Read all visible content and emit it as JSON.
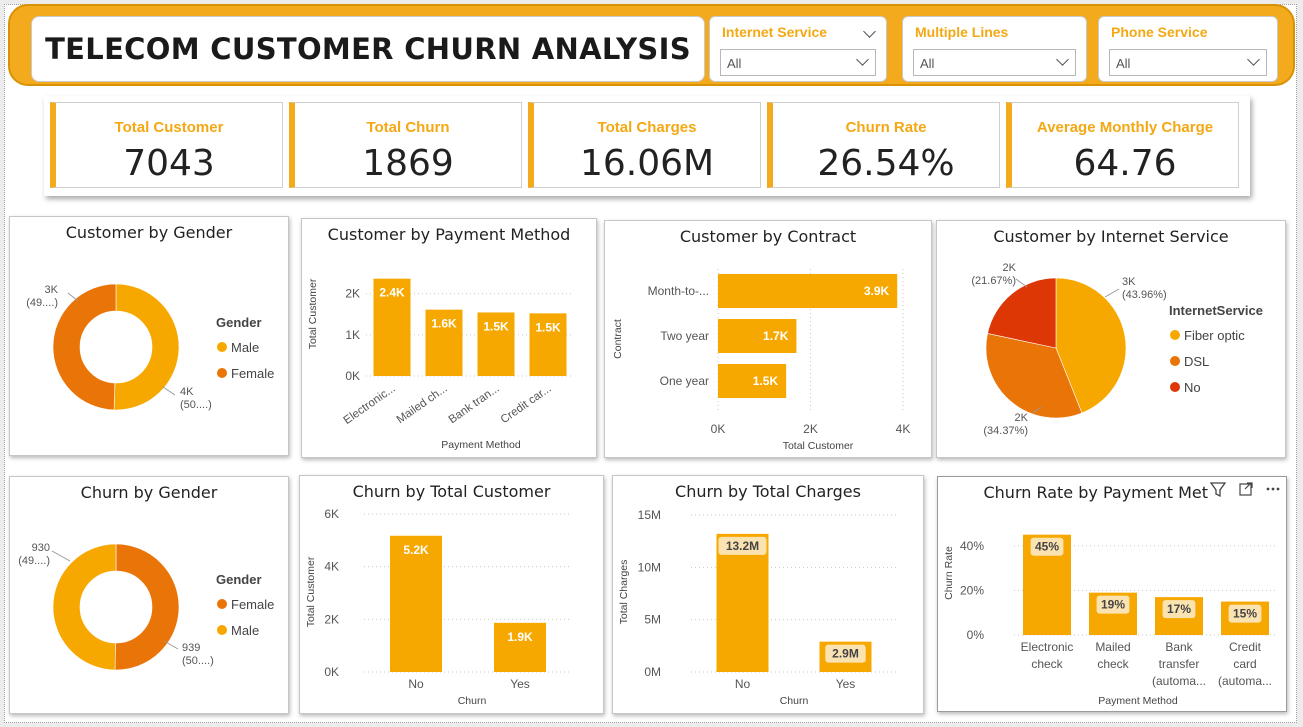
{
  "header": {
    "title": "TELECOM CUSTOMER CHURN ANALYSIS",
    "slicers": [
      {
        "label": "Internet Service",
        "value": "All"
      },
      {
        "label": "Multiple Lines",
        "value": "All"
      },
      {
        "label": "Phone Service",
        "value": "All"
      }
    ]
  },
  "kpis": [
    {
      "label": "Total Customer",
      "value": "7043"
    },
    {
      "label": "Total Churn",
      "value": "1869"
    },
    {
      "label": "Total Charges",
      "value": "16.06M"
    },
    {
      "label": "Churn Rate",
      "value": "26.54%"
    },
    {
      "label": "Average Monthly Charge",
      "value": "64.76"
    }
  ],
  "colors": {
    "accent": "#f3ab1d",
    "bar": "#f7a800",
    "orange": "#e97408",
    "red": "#dd3706",
    "label_bg": "#fbe3b1"
  },
  "chart_data": [
    {
      "type": "pie",
      "donut": true,
      "title": "Customer by Gender",
      "legend_title": "Gender",
      "categories": [
        "Male",
        "Female"
      ],
      "values": [
        3555,
        3488
      ],
      "data_labels": [
        "4K\n(50....)",
        "3K\n(49....)"
      ],
      "colors": [
        "#f7a800",
        "#e97408"
      ],
      "legend": "right"
    },
    {
      "type": "bar",
      "title": "Customer by Payment Method",
      "categories": [
        "Electronic...",
        "Mailed ch...",
        "Bank tran...",
        "Credit car..."
      ],
      "values": [
        2365,
        1612,
        1544,
        1522
      ],
      "data_labels": [
        "2.4K",
        "1.6K",
        "1.5K",
        "1.5K"
      ],
      "ylabel": "Total Customer",
      "xlabel": "Payment Method",
      "yticks": [
        "0K",
        "1K",
        "2K"
      ],
      "ylim": [
        0,
        2600
      ]
    },
    {
      "type": "bar",
      "orientation": "horizontal",
      "title": "Customer by Contract",
      "categories": [
        "Month-to-...",
        "Two year",
        "One year"
      ],
      "values": [
        3875,
        1695,
        1473
      ],
      "data_labels": [
        "3.9K",
        "1.7K",
        "1.5K"
      ],
      "ylabel": "Contract",
      "xlabel": "Total Customer",
      "xticks": [
        "0K",
        "2K",
        "4K"
      ],
      "xlim": [
        0,
        4000
      ]
    },
    {
      "type": "pie",
      "title": "Customer by Internet Service",
      "legend_title": "InternetService",
      "categories": [
        "Fiber optic",
        "DSL",
        "No"
      ],
      "values": [
        43.96,
        34.37,
        21.67
      ],
      "data_labels": [
        "3K\n(43.96%)",
        "2K\n(34.37%)",
        "2K\n(21.67%)"
      ],
      "colors": [
        "#f7a800",
        "#e97408",
        "#dd3706"
      ],
      "legend": "right"
    },
    {
      "type": "pie",
      "donut": true,
      "title": "Churn by Gender",
      "legend_title": "Gender",
      "categories": [
        "Female",
        "Male"
      ],
      "values": [
        939,
        930
      ],
      "data_labels": [
        "939\n(50....)",
        "930\n(49....)"
      ],
      "colors": [
        "#e97408",
        "#f7a800"
      ],
      "legend": "right"
    },
    {
      "type": "bar",
      "title": "Churn by Total Customer",
      "categories": [
        "No",
        "Yes"
      ],
      "values": [
        5174,
        1869
      ],
      "data_labels": [
        "5.2K",
        "1.9K"
      ],
      "ylabel": "Total Customer",
      "xlabel": "Churn",
      "yticks": [
        "0K",
        "2K",
        "4K",
        "6K"
      ],
      "ylim": [
        0,
        6000
      ]
    },
    {
      "type": "bar",
      "title": "Churn by Total Charges",
      "categories": [
        "No",
        "Yes"
      ],
      "values": [
        13.2,
        2.9
      ],
      "data_labels": [
        "13.2M",
        "2.9M"
      ],
      "ylabel": "Total Charges",
      "xlabel": "Churn",
      "yticks": [
        "0M",
        "5M",
        "10M",
        "15M"
      ],
      "ylim": [
        0,
        15
      ]
    },
    {
      "type": "bar",
      "title": "Churn Rate by Payment Method",
      "title_visible": "Churn Rate by Payment Met",
      "categories": [
        "Electronic\ncheck",
        "Mailed\ncheck",
        "Bank\ntransfer\n(automa...",
        "Credit\ncard\n(automa..."
      ],
      "values": [
        45,
        19,
        17,
        15
      ],
      "data_labels": [
        "45%",
        "19%",
        "17%",
        "15%"
      ],
      "ylabel": "Churn Rate",
      "xlabel": "Payment Method",
      "yticks": [
        "0%",
        "20%",
        "40%"
      ],
      "ylim": [
        0,
        48
      ]
    }
  ]
}
